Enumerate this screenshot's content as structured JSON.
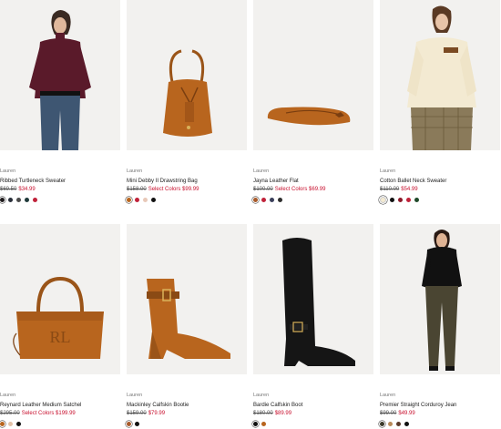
{
  "products": [
    {
      "brand": "Lauren",
      "name": "Ribbed Turtleneck Sweater",
      "price_original": "$69.50",
      "price_sale": "$34.99",
      "swatches": [
        "#1e1a1c",
        "#2a2f3a",
        "#4b4b4b",
        "#1f3a3a",
        "#c0223a"
      ],
      "image": "model-turtleneck"
    },
    {
      "brand": "Lauren",
      "name": "Mini Debby II Drawstring Bag",
      "price_original": "$158.00",
      "price_sale": "Select Colors $99.99",
      "swatches": [
        "#b8651e",
        "#c0223a",
        "#e8c8b8",
        "#111111"
      ],
      "image": "drawstring-bag"
    },
    {
      "brand": "Lauren",
      "name": "Jayna Leather Flat",
      "price_original": "$100.00",
      "price_sale": "Select Colors $69.99",
      "swatches": [
        "#a85a2a",
        "#c0223a",
        "#3a3f5a",
        "#2e2e2e"
      ],
      "image": "leather-flat"
    },
    {
      "brand": "Lauren",
      "name": "Cotton Ballet Neck Sweater",
      "price_original": "$110.00",
      "price_sale": "$54.99",
      "swatches": [
        "#f3ead2",
        "#111111",
        "#8c1a2a",
        "#c0223a",
        "#1f4a2a"
      ],
      "image": "model-ballet-sweater"
    },
    {
      "brand": "Lauren",
      "name": "Reynard Leather Medium Satchel",
      "price_original": "$295.00",
      "price_sale": "Select Colors $199.99",
      "swatches": [
        "#b8651e",
        "#e2c2a8",
        "#111111"
      ],
      "image": "satchel"
    },
    {
      "brand": "Lauren",
      "name": "Mackinley Calfskin Bootie",
      "price_original": "$159.00",
      "price_sale": "$79.99",
      "swatches": [
        "#a85a2a",
        "#111111"
      ],
      "image": "bootie"
    },
    {
      "brand": "Lauren",
      "name": "Bardie Calfskin Boot",
      "price_original": "$180.00",
      "price_sale": "$89.99",
      "swatches": [
        "#111111",
        "#b8651e"
      ],
      "image": "tall-boot"
    },
    {
      "brand": "Lauren",
      "name": "Premier Straight Corduroy Jean",
      "price_original": "$99.00",
      "price_sale": "$49.99",
      "swatches": [
        "#3a3a2a",
        "#b88a5a",
        "#5a3a2a",
        "#111111"
      ],
      "image": "model-corduroy"
    }
  ],
  "colors": {
    "sale": "#c8102e",
    "image_bg": "#f2f1ef"
  }
}
